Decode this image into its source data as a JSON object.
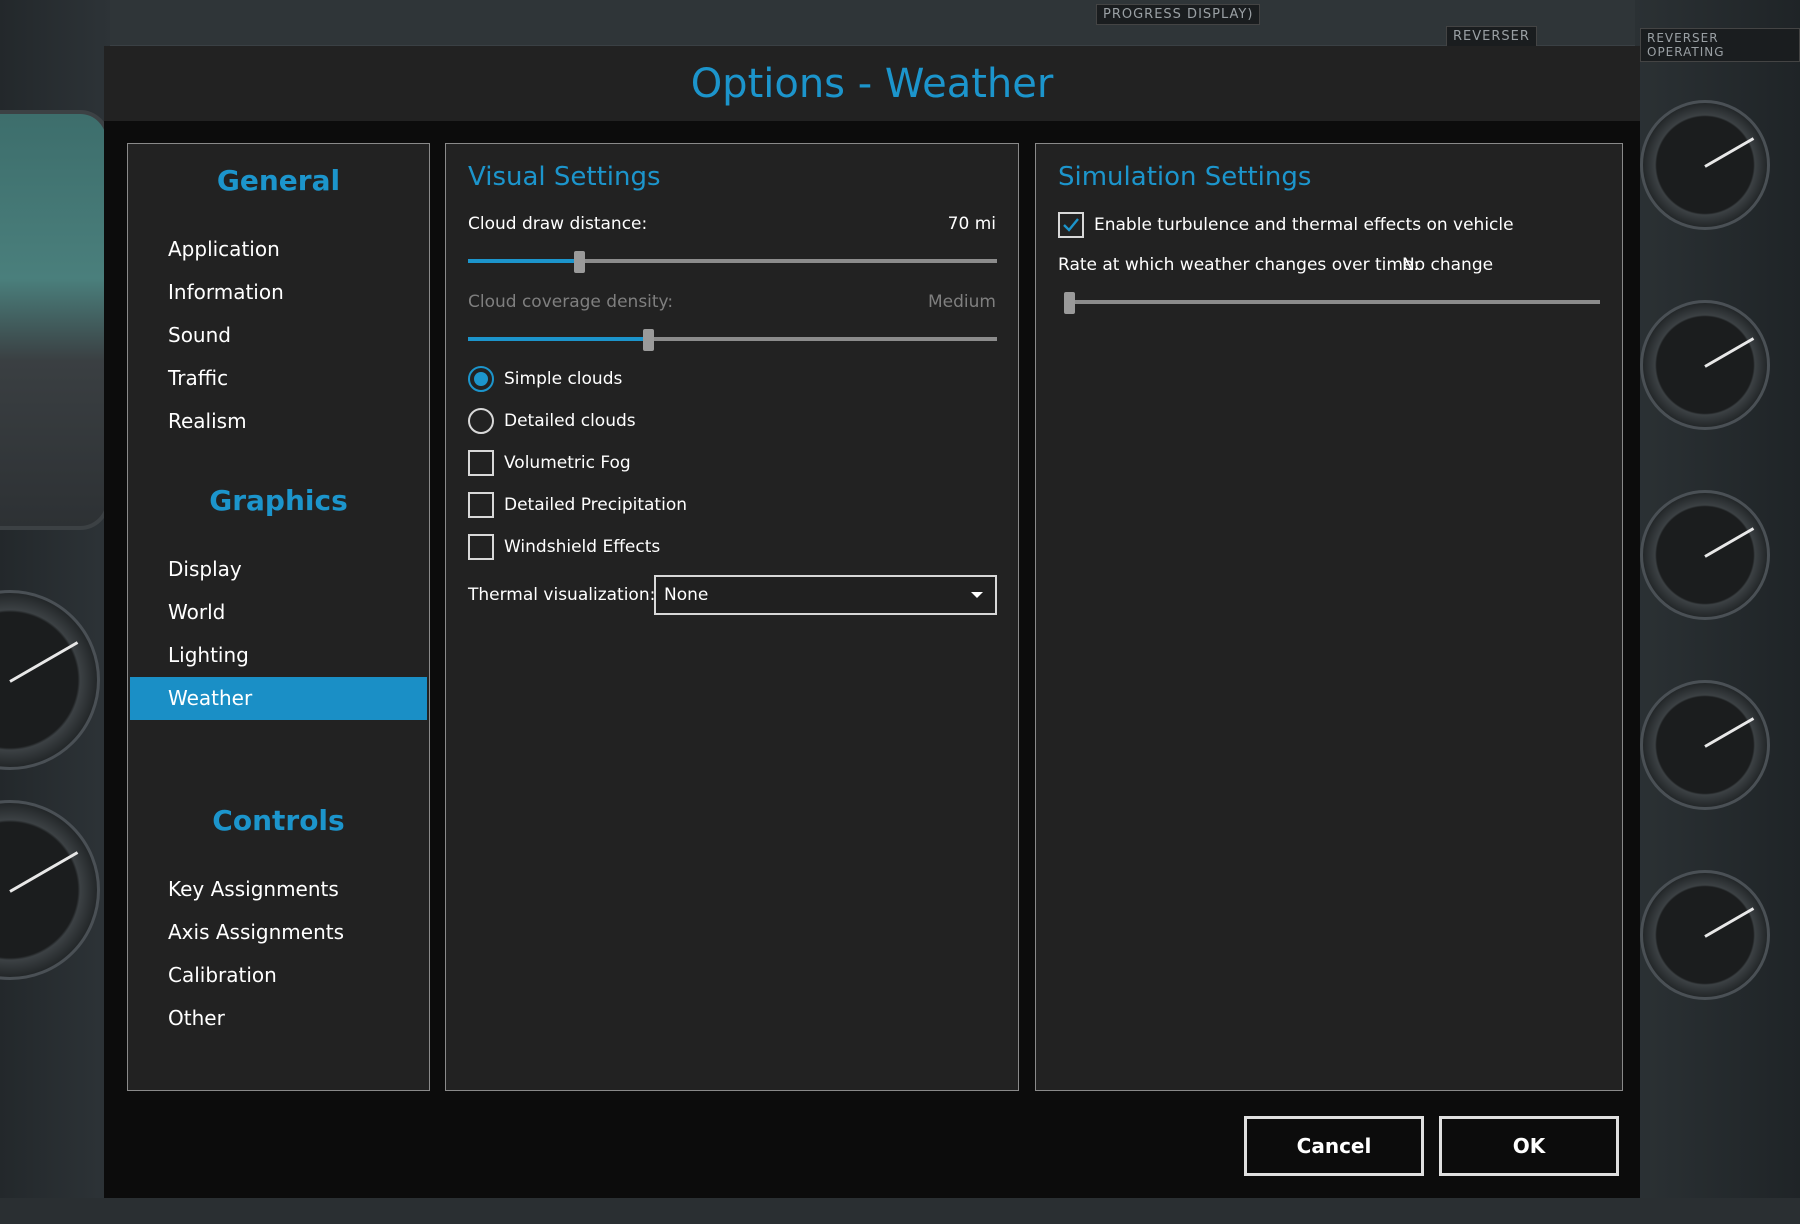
{
  "background": {
    "plates": [
      "PROGRESS DISPLAY)",
      "REVERSER",
      "REVERSER OPERATING"
    ]
  },
  "dialog": {
    "title": "Options - Weather"
  },
  "nav": {
    "sections": [
      {
        "title": "General",
        "items": [
          "Application",
          "Information",
          "Sound",
          "Traffic",
          "Realism"
        ]
      },
      {
        "title": "Graphics",
        "items": [
          "Display",
          "World",
          "Lighting",
          "Weather"
        ]
      },
      {
        "title": "Controls",
        "items": [
          "Key Assignments",
          "Axis Assignments",
          "Calibration",
          "Other"
        ]
      }
    ],
    "active_item": "Weather"
  },
  "visual": {
    "title": "Visual Settings",
    "cloud_draw_distance": {
      "label": "Cloud draw distance:",
      "value": "70 mi",
      "level": 0.21
    },
    "cloud_coverage_density": {
      "label": "Cloud coverage density:",
      "value": "Medium",
      "level": 0.34
    },
    "radios": [
      {
        "label": "Simple clouds",
        "selected": true
      },
      {
        "label": "Detailed clouds",
        "selected": false
      }
    ],
    "checkboxes": [
      {
        "label": "Volumetric Fog",
        "checked": false
      },
      {
        "label": "Detailed Precipitation",
        "checked": false
      },
      {
        "label": "Windshield Effects",
        "checked": false
      }
    ],
    "thermal": {
      "label": "Thermal visualization:",
      "value": "None"
    }
  },
  "simulation": {
    "title": "Simulation Settings",
    "turbulence": {
      "label": "Enable turbulence and thermal effects on vehicle",
      "checked": true
    },
    "rate": {
      "label": "Rate at which weather changes over time:",
      "value": "No change",
      "level": 0.0
    }
  },
  "buttons": {
    "cancel": "Cancel",
    "ok": "OK"
  },
  "colors": {
    "accent": "#1c95cc",
    "panel": "#222222",
    "dialog": "#0c0c0c"
  }
}
